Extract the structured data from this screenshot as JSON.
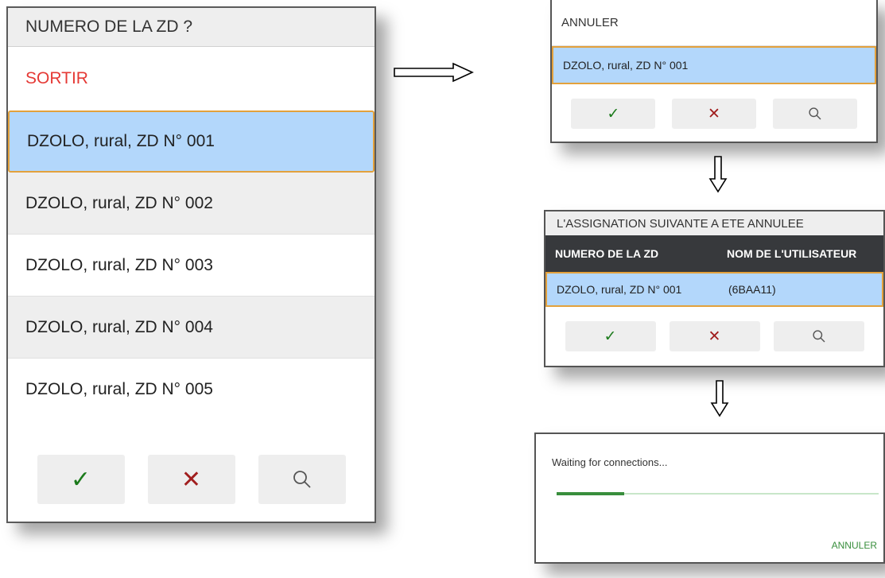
{
  "left_dialog": {
    "title": "NUMERO DE LA ZD ?",
    "exit_label": "SORTIR",
    "items": [
      {
        "label": "DZOLO, rural, ZD N° 001"
      },
      {
        "label": "DZOLO, rural, ZD N° 002"
      },
      {
        "label": "DZOLO, rural, ZD N° 003"
      },
      {
        "label": "DZOLO, rural, ZD N° 004"
      },
      {
        "label": "DZOLO, rural, ZD N° 005"
      }
    ],
    "selected_index": 0
  },
  "top_right_dialog": {
    "cancel_label": "ANNULER",
    "selected_item": "DZOLO, rural, ZD N° 001"
  },
  "middle_right_dialog": {
    "title": "L'ASSIGNATION SUIVANTE A ETE ANNULEE",
    "col_zd": "NUMERO DE LA ZD",
    "col_user": "NOM DE L'UTILISATEUR",
    "row_zd": "DZOLO, rural, ZD N° 001",
    "row_user": "(6BAA11)"
  },
  "bottom_right_dialog": {
    "message": "Waiting for connections...",
    "cancel_label": "ANNULER",
    "progress_fraction": 0.21
  },
  "icons": {
    "confirm": "check-icon",
    "cancel": "close-icon",
    "search": "search-icon"
  },
  "colors": {
    "selected_bg": "#b3d7fb",
    "selected_border": "#e3a13c",
    "exit_red": "#e53935",
    "check_green": "#1b7a1b",
    "close_red": "#a11e1e",
    "progress_green": "#388e3c",
    "table_header_bg": "#37393c"
  }
}
